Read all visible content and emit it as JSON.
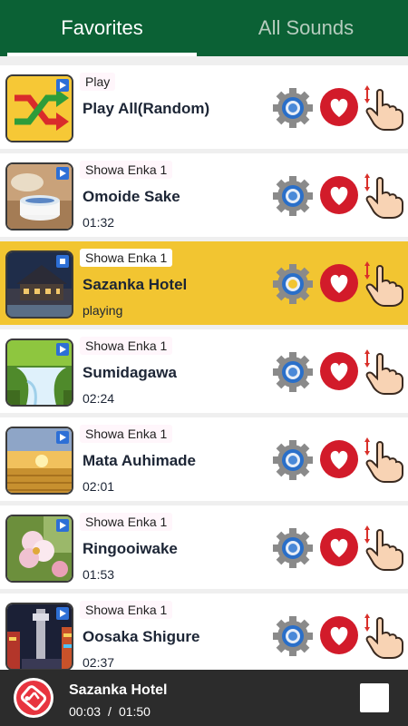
{
  "tabs": [
    {
      "label": "Favorites",
      "active": true
    },
    {
      "label": "All Sounds",
      "active": false
    }
  ],
  "colors": {
    "header": "#0b6135",
    "playing_row": "#f2c531",
    "heart": "#d21b2a",
    "player_bar": "#2c2c2c"
  },
  "list": {
    "items": [
      {
        "category": "Play",
        "title": "Play All(Random)",
        "subtitle": "",
        "thumb": "shuffle-icon",
        "playing": false
      },
      {
        "category": "Showa Enka 1",
        "title": "Omoide Sake",
        "subtitle": "01:32",
        "thumb": "sake-cup",
        "playing": false
      },
      {
        "category": "Showa Enka 1",
        "title": "Sazanka Hotel",
        "subtitle": "playing",
        "thumb": "hotel-night",
        "playing": true
      },
      {
        "category": "Showa Enka 1",
        "title": "Sumidagawa",
        "subtitle": "02:24",
        "thumb": "waterfall",
        "playing": false
      },
      {
        "category": "Showa Enka 1",
        "title": "Mata Auhimade",
        "subtitle": "02:01",
        "thumb": "sunset-field",
        "playing": false
      },
      {
        "category": "Showa Enka 1",
        "title": "Ringooiwake",
        "subtitle": "01:53",
        "thumb": "apple-blossom",
        "playing": false
      },
      {
        "category": "Showa Enka 1",
        "title": "Oosaka Shigure",
        "subtitle": "02:37",
        "thumb": "osaka-tower",
        "playing": false
      }
    ]
  },
  "player": {
    "title": "Sazanka Hotel",
    "elapsed": "00:03",
    "separator": "/",
    "duration": "01:50"
  }
}
